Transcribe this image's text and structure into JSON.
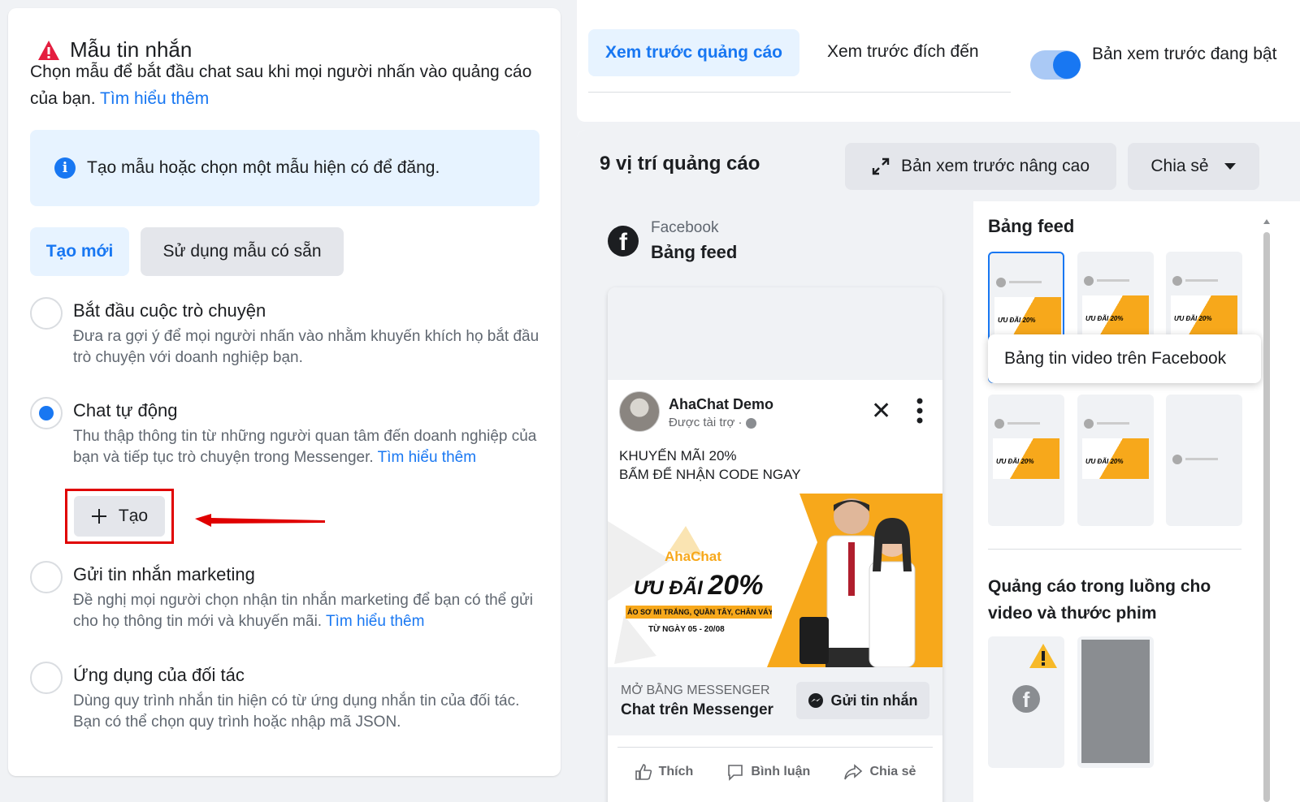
{
  "left": {
    "title": "Mẫu tin nhắn",
    "description": "Chọn mẫu để bắt đầu chat sau khi mọi người nhấn vào quảng cáo của bạn.",
    "learn_more": "Tìm hiểu thêm",
    "info_text": "Tạo mẫu hoặc chọn một mẫu hiện có để đăng.",
    "tab_new": "Tạo mới",
    "tab_existing": "Sử dụng mẫu có sẵn",
    "options": [
      {
        "title": "Bắt đầu cuộc trò chuyện",
        "desc": "Đưa ra gợi ý để mọi người nhấn vào nhằm khuyến khích họ bắt đầu trò chuyện với doanh nghiệp bạn."
      },
      {
        "title": "Chat tự động",
        "desc": "Thu thập thông tin từ những người quan tâm đến doanh nghiệp của bạn và tiếp tục trò chuyện trong Messenger.",
        "link": "Tìm hiểu thêm"
      },
      {
        "title": "Gửi tin nhắn marketing",
        "desc": "Đề nghị mọi người chọn nhận tin nhắn marketing để bạn có thể gửi cho họ thông tin mới và khuyến mãi.",
        "link": "Tìm hiểu thêm"
      },
      {
        "title": "Ứng dụng của đối tác",
        "desc": "Dùng quy trình nhắn tin hiện có từ ứng dụng nhắn tin của đối tác. Bạn có thể chọn quy trình hoặc nhập mã JSON."
      }
    ],
    "create_button": "Tạo"
  },
  "right_top": {
    "tab_ad_preview": "Xem trước quảng cáo",
    "tab_destination": "Xem trước đích đến",
    "toggle_label": "Bản xem trước đang bật"
  },
  "right_main": {
    "placements_count": "9 vị trí quảng cáo",
    "advanced_preview": "Bản xem trước nâng cao",
    "share": "Chia sẻ",
    "platform": "Facebook",
    "placement": "Bảng feed",
    "post": {
      "page_name": "AhaChat Demo",
      "sponsored": "Được tài trợ ·",
      "text_line1": "KHUYẾN MÃI 20%",
      "text_line2": "BẤM ĐỂ NHẬN CODE NGAY",
      "ad_brand": "AhaChat",
      "ad_headline": "ƯU ĐÃI",
      "ad_percent": "20%",
      "ad_sub": "ÁO SƠ MI TRẮNG, QUẦN TÂY, CHÂN VÁY",
      "ad_date": "TỪ NGÀY 05 - 20/08",
      "cta_small": "MỞ BẰNG MESSENGER",
      "cta_main": "Chat trên Messenger",
      "cta_button": "Gửi tin nhắn",
      "like": "Thích",
      "comment": "Bình luận",
      "share": "Chia sẻ"
    },
    "sidebar": {
      "title_feed": "Bảng feed",
      "tooltip": "Bảng tin video trên Facebook",
      "title_instream": "Quảng cáo trong luồng cho video và thước phim"
    }
  },
  "colors": {
    "accent": "#1877f2",
    "highlight_box": "#e00000",
    "warning": "#e41e3f"
  }
}
